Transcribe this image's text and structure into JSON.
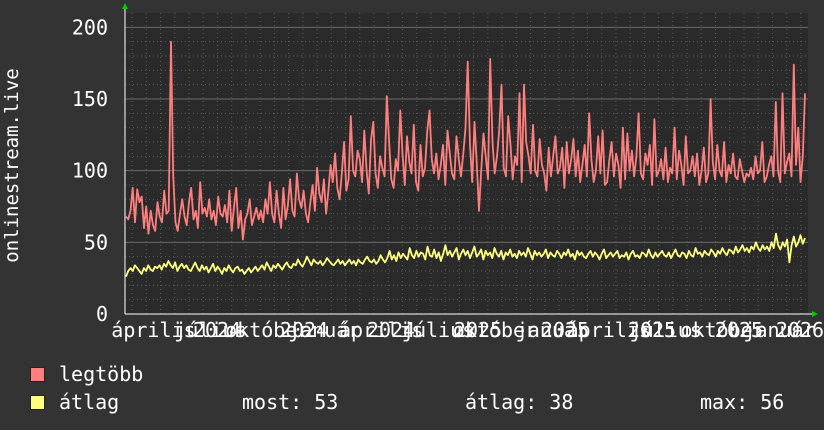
{
  "chart_data": {
    "type": "line",
    "ylabel": "onlinestream.live",
    "ylim": [
      0,
      210
    ],
    "yticks": [
      0,
      50,
      100,
      150,
      200
    ],
    "grid": true,
    "xticks": [
      "április",
      "július",
      "október",
      "január",
      "április",
      "július",
      "október",
      "január",
      "április",
      "július",
      "október",
      "január"
    ],
    "xtick_years": [
      "2024",
      "2024",
      "2024",
      "2025",
      "2025",
      "2025",
      "2025",
      "2026"
    ],
    "series": [
      {
        "name": "legtöbb",
        "color": "#ff7f7f",
        "values": [
          68,
          66,
          72,
          88,
          64,
          87,
          78,
          82,
          60,
          75,
          56,
          72,
          62,
          58,
          78,
          68,
          64,
          86,
          70,
          72,
          190,
          96,
          64,
          58,
          70,
          80,
          68,
          62,
          78,
          88,
          66,
          72,
          60,
          92,
          70,
          74,
          68,
          80,
          66,
          72,
          62,
          82,
          70,
          68,
          76,
          64,
          86,
          58,
          74,
          88,
          60,
          72,
          52,
          66,
          70,
          80,
          62,
          68,
          74,
          66,
          72,
          64,
          80,
          70,
          92,
          70,
          64,
          86,
          70,
          60,
          88,
          66,
          76,
          94,
          72,
          68,
          98,
          80,
          74,
          86,
          70,
          64,
          78,
          90,
          72,
          102,
          84,
          78,
          94,
          70,
          86,
          104,
          92,
          112,
          88,
          80,
          98,
          120,
          86,
          94,
          138,
          100,
          96,
          114,
          108,
          92,
          128,
          100,
          84,
          122,
          134,
          98,
          88,
          110,
          102,
          96,
          152,
          120,
          94,
          88,
          108,
          100,
          142,
          112,
          90,
          124,
          106,
          98,
          132,
          92,
          86,
          118,
          96,
          102,
          128,
          142,
          108,
          98,
          112,
          94,
          104,
          118,
          90,
          128,
          112,
          98,
          94,
          124,
          108,
          96,
          112,
          130,
          176,
          118,
          92,
          134,
          106,
          72,
          100,
          126,
          110,
          94,
          178,
          120,
          98,
          110,
          128,
          160,
          102,
          96,
          138,
          118,
          94,
          110,
          104,
          154,
          92,
          160,
          120,
          110,
          98,
          132,
          100,
          96,
          122,
          104,
          98,
          86,
          116,
          96,
          110,
          124,
          98,
          102,
          116,
          88,
          120,
          98,
          108,
          122,
          96,
          114,
          92,
          104,
          118,
          96,
          140,
          108,
          92,
          100,
          124,
          98,
          128,
          90,
          92,
          108,
          120,
          96,
          112,
          104,
          88,
          130,
          94,
          126,
          100,
          114,
          96,
          110,
          140,
          98,
          94,
          112,
          104,
          118,
          90,
          136,
          96,
          100,
          108,
          94,
          116,
          92,
          102,
          98,
          130,
          94,
          114,
          104,
          90,
          124,
          98,
          100,
          110,
          96,
          112,
          90,
          100,
          116,
          92,
          98,
          150,
          106,
          94,
          118,
          100,
          96,
          120,
          92,
          104,
          98,
          112,
          96,
          94,
          108,
          100,
          92,
          98,
          96,
          102,
          94,
          110,
          98,
          100,
          120,
          92,
          96,
          104,
          110,
          96,
          148,
          100,
          92,
          154,
          98,
          106,
          112,
          96,
          174,
          104,
          130,
          92,
          110,
          154
        ]
      },
      {
        "name": "átlag",
        "color": "#ffff80",
        "values": [
          26,
          30,
          32,
          30,
          34,
          32,
          30,
          28,
          32,
          30,
          34,
          31,
          30,
          33,
          32,
          34,
          31,
          35,
          33,
          37,
          34,
          32,
          36,
          30,
          33,
          35,
          32,
          34,
          31,
          30,
          33,
          36,
          32,
          30,
          34,
          31,
          33,
          29,
          32,
          35,
          30,
          33,
          31,
          28,
          32,
          30,
          34,
          31,
          29,
          32,
          33,
          30,
          31,
          28,
          30,
          32,
          29,
          31,
          33,
          30,
          32,
          34,
          31,
          36,
          33,
          30,
          34,
          32,
          35,
          33,
          31,
          34,
          36,
          33,
          32,
          35,
          34,
          38,
          35,
          33,
          36,
          40,
          37,
          34,
          38,
          36,
          35,
          37,
          34,
          36,
          39,
          37,
          35,
          34,
          36,
          38,
          35,
          37,
          34,
          36,
          38,
          35,
          37,
          34,
          38,
          36,
          35,
          38,
          40,
          37,
          36,
          38,
          35,
          37,
          41,
          38,
          36,
          39,
          44,
          38,
          41,
          37,
          43,
          39,
          42,
          40,
          38,
          46,
          41,
          39,
          44,
          40,
          43,
          42,
          38,
          47,
          41,
          40,
          45,
          39,
          43,
          37,
          42,
          48,
          41,
          44,
          40,
          43,
          46,
          38,
          42,
          45,
          41,
          44,
          39,
          43,
          47,
          40,
          42,
          45,
          38,
          44,
          41,
          43,
          39,
          46,
          42,
          40,
          44,
          38,
          43,
          41,
          45,
          40,
          42,
          39,
          44,
          41,
          43,
          40,
          46,
          42,
          38,
          44,
          41,
          43,
          40,
          42,
          45,
          39,
          43,
          41,
          40,
          44,
          42,
          39,
          43,
          41,
          45,
          40,
          42,
          38,
          44,
          41,
          43,
          40,
          39,
          42,
          44,
          40,
          43,
          41,
          38,
          42,
          45,
          39,
          41,
          43,
          40,
          42,
          44,
          39,
          41,
          40,
          43,
          38,
          42,
          44,
          40,
          41,
          39,
          43,
          42,
          40,
          45,
          41,
          39,
          43,
          40,
          42,
          44,
          41,
          40,
          43,
          39,
          42,
          45,
          41,
          40,
          43,
          42,
          39,
          44,
          41,
          40,
          46,
          42,
          43,
          40,
          44,
          42,
          41,
          45,
          43,
          40,
          44,
          42,
          46,
          43,
          41,
          45,
          44,
          42,
          47,
          43,
          45,
          48,
          44,
          46,
          43,
          47,
          45,
          50,
          46,
          44,
          48,
          45,
          47,
          44,
          50,
          46,
          56,
          48,
          45,
          50,
          47,
          52,
          36,
          48,
          54,
          47,
          50,
          55,
          49,
          53
        ]
      }
    ]
  },
  "legend": {
    "items": [
      {
        "label": "legtöbb",
        "color": "#ff7f7f"
      },
      {
        "label": "átlag",
        "color": "#ffff80"
      }
    ],
    "stats": {
      "now_label": "most:",
      "now_value": "53",
      "avg_label": "átlag:",
      "avg_value": "38",
      "max_label": "max:",
      "max_value": "56"
    }
  },
  "colors": {
    "background": "#333333",
    "plot_background": "#2a2a2a",
    "grid": "#5a5a5a",
    "axis": "#ffffff",
    "arrow": "#00cc00"
  }
}
